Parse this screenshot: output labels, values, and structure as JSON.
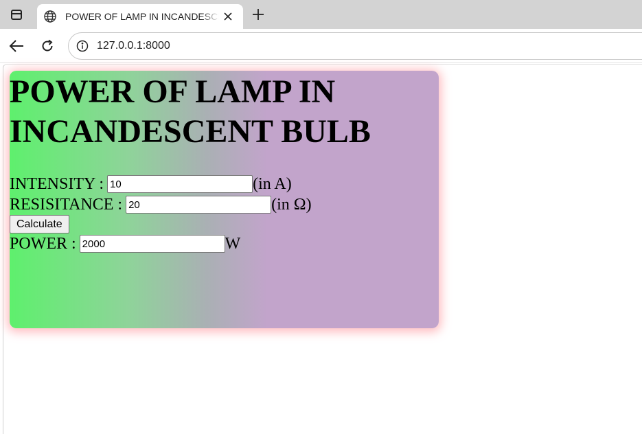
{
  "browser": {
    "tab": {
      "title": "POWER OF LAMP IN INCANDESCENT BULB",
      "favicon": "globe-icon"
    },
    "address_bar": {
      "url": "127.0.0.1:8000"
    }
  },
  "page": {
    "heading": "POWER OF LAMP IN INCANDESCENT BULB",
    "intensity": {
      "label": "INTENSITY :",
      "value": "10",
      "unit": "(in A)"
    },
    "resistance": {
      "label": "RESISITANCE :",
      "value": "20",
      "unit": "(in Ω)"
    },
    "calculate_label": "Calculate",
    "power": {
      "label": "POWER :",
      "value": "2000",
      "unit": "W"
    },
    "colors": {
      "gradient_start": "#5ef06d",
      "gradient_end": "#c2a4cb",
      "shadow": "#ffaaaf"
    }
  }
}
